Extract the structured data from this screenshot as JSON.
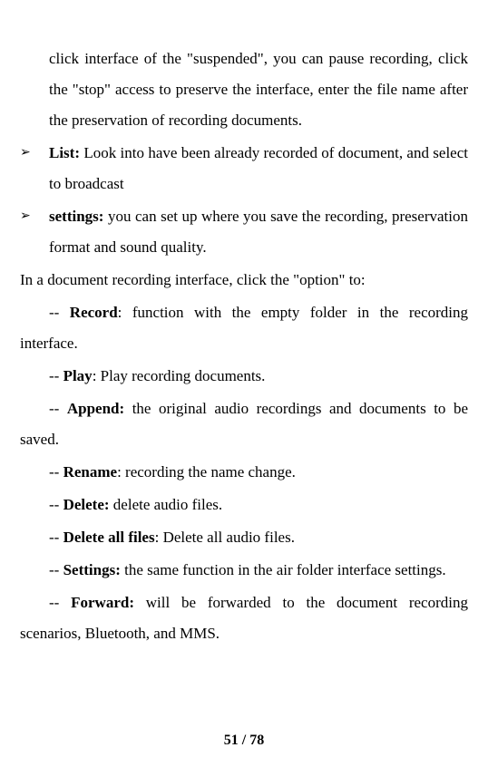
{
  "intro_paragraph": "click interface of the \"suspended\", you can pause recording, click the \"stop\" access to preserve the interface, enter the file name after the preservation of recording documents.",
  "bullets": [
    {
      "label": "List:",
      "text": " Look into have been already recorded of document, and select to broadcast"
    },
    {
      "label": "settings:",
      "text": " you can set up where you save the recording, preservation format and sound quality."
    }
  ],
  "mid_paragraph": "In a document recording interface, click the \"option\" to:",
  "options": [
    {
      "prefix": "-- ",
      "label": "Record",
      "text": ": function with the empty folder in the recording interface."
    },
    {
      "prefix": "-- ",
      "label": "Play",
      "text": ": Play recording documents."
    },
    {
      "prefix": "-- ",
      "label": "Append:",
      "text": " the original audio recordings and documents to be saved."
    },
    {
      "prefix": "-- ",
      "label": "Rename",
      "text": ": recording the name change."
    },
    {
      "prefix": "-- ",
      "label": "Delete:",
      "text": " delete audio files."
    },
    {
      "prefix": "-- ",
      "label": "Delete all files",
      "text": ": Delete all audio files."
    },
    {
      "prefix": "-- ",
      "label": "Settings:",
      "text": " the same function in the air folder interface settings."
    },
    {
      "prefix": "-- ",
      "label": "Forward:",
      "text": " will be forwarded to the document recording scenarios, Bluetooth, and MMS."
    }
  ],
  "page_number": "51 / 78",
  "bullet_glyph": "➢"
}
